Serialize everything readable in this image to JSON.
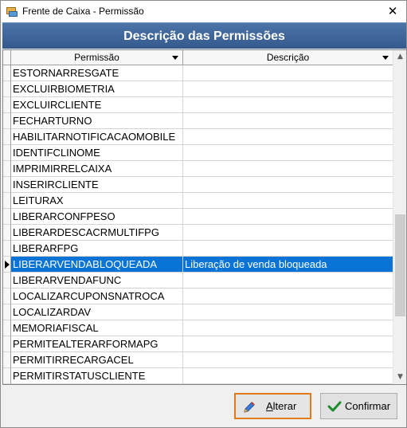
{
  "window": {
    "title": "Frente de Caixa - Permissão",
    "close_glyph": "✕"
  },
  "banner": {
    "title": "Descrição das Permissões"
  },
  "grid": {
    "columns": {
      "permissao": "Permissão",
      "descricao": "Descrição"
    },
    "rows": [
      {
        "permissao": "ESTORNARRESGATE",
        "descricao": ""
      },
      {
        "permissao": "EXCLUIRBIOMETRIA",
        "descricao": ""
      },
      {
        "permissao": "EXCLUIRCLIENTE",
        "descricao": ""
      },
      {
        "permissao": "FECHARTURNO",
        "descricao": ""
      },
      {
        "permissao": "HABILITARNOTIFICACAOMOBILE",
        "descricao": ""
      },
      {
        "permissao": "IDENTIFCLINOME",
        "descricao": ""
      },
      {
        "permissao": "IMPRIMIRRELCAIXA",
        "descricao": ""
      },
      {
        "permissao": "INSERIRCLIENTE",
        "descricao": ""
      },
      {
        "permissao": "LEITURAX",
        "descricao": ""
      },
      {
        "permissao": "LIBERARCONFPESO",
        "descricao": ""
      },
      {
        "permissao": "LIBERARDESCACRMULTIFPG",
        "descricao": ""
      },
      {
        "permissao": "LIBERARFPG",
        "descricao": ""
      },
      {
        "permissao": "LIBERARVENDABLOQUEADA",
        "descricao": "Liberação de venda bloqueada",
        "selected": true
      },
      {
        "permissao": "LIBERARVENDAFUNC",
        "descricao": ""
      },
      {
        "permissao": "LOCALIZARCUPONSNATROCA",
        "descricao": ""
      },
      {
        "permissao": "LOCALIZARDAV",
        "descricao": ""
      },
      {
        "permissao": "MEMORIAFISCAL",
        "descricao": ""
      },
      {
        "permissao": "PERMITEALTERARFORMAPG",
        "descricao": ""
      },
      {
        "permissao": "PERMITIRRECARGACEL",
        "descricao": ""
      },
      {
        "permissao": "PERMITIRSTATUSCLIENTE",
        "descricao": ""
      }
    ]
  },
  "buttons": {
    "alterar_first": "A",
    "alterar_rest": "lterar",
    "confirmar": "Confirmar"
  },
  "colors": {
    "banner": "#4c74a8",
    "selection": "#0a74d6",
    "focus_border": "#e07b1a",
    "check_green": "#1e8c2d"
  },
  "icons": {
    "alterar": "pencil-icon",
    "confirmar": "checkmark-icon"
  }
}
